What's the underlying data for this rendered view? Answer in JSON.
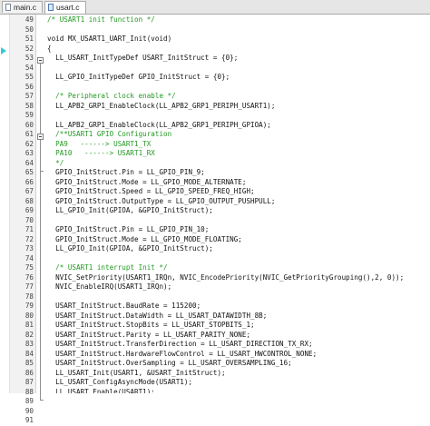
{
  "tabs": [
    {
      "label": "main.c",
      "active": false
    },
    {
      "label": "usart.c",
      "active": true
    }
  ],
  "colors": {
    "comment": "#229922",
    "code": "#111111",
    "current_line_marker": "#38c7d6"
  },
  "editor": {
    "lines": [
      {
        "num": "49",
        "text": "/* USART1 init function */",
        "type": "comment"
      },
      {
        "num": "50",
        "text": "",
        "type": "code"
      },
      {
        "num": "51",
        "text": "void MX_USART1_UART_Init(void)",
        "type": "code"
      },
      {
        "num": "52",
        "text": "{",
        "type": "code"
      },
      {
        "num": "53",
        "text": "  LL_USART_InitTypeDef USART_InitStruct = {0};",
        "type": "code"
      },
      {
        "num": "54",
        "text": "",
        "type": "code"
      },
      {
        "num": "55",
        "text": "  LL_GPIO_InitTypeDef GPIO_InitStruct = {0};",
        "type": "code"
      },
      {
        "num": "56",
        "text": "",
        "type": "code"
      },
      {
        "num": "57",
        "text": "  /* Peripheral clock enable */",
        "type": "comment"
      },
      {
        "num": "58",
        "text": "  LL_APB2_GRP1_EnableClock(LL_APB2_GRP1_PERIPH_USART1);",
        "type": "code"
      },
      {
        "num": "59",
        "text": "",
        "type": "code"
      },
      {
        "num": "60",
        "text": "  LL_APB2_GRP1_EnableClock(LL_APB2_GRP1_PERIPH_GPIOA);",
        "type": "code"
      },
      {
        "num": "61",
        "text": "  /**USART1 GPIO Configuration",
        "type": "comment"
      },
      {
        "num": "62",
        "text": "  PA9   ------> USART1_TX",
        "type": "comment"
      },
      {
        "num": "63",
        "text": "  PA10   ------> USART1_RX",
        "type": "comment"
      },
      {
        "num": "64",
        "text": "  */",
        "type": "comment"
      },
      {
        "num": "65",
        "text": "  GPIO_InitStruct.Pin = LL_GPIO_PIN_9;",
        "type": "code"
      },
      {
        "num": "66",
        "text": "  GPIO_InitStruct.Mode = LL_GPIO_MODE_ALTERNATE;",
        "type": "code"
      },
      {
        "num": "67",
        "text": "  GPIO_InitStruct.Speed = LL_GPIO_SPEED_FREQ_HIGH;",
        "type": "code"
      },
      {
        "num": "68",
        "text": "  GPIO_InitStruct.OutputType = LL_GPIO_OUTPUT_PUSHPULL;",
        "type": "code"
      },
      {
        "num": "69",
        "text": "  LL_GPIO_Init(GPIOA, &GPIO_InitStruct);",
        "type": "code"
      },
      {
        "num": "70",
        "text": "",
        "type": "code"
      },
      {
        "num": "71",
        "text": "  GPIO_InitStruct.Pin = LL_GPIO_PIN_10;",
        "type": "code"
      },
      {
        "num": "72",
        "text": "  GPIO_InitStruct.Mode = LL_GPIO_MODE_FLOATING;",
        "type": "code"
      },
      {
        "num": "73",
        "text": "  LL_GPIO_Init(GPIOA, &GPIO_InitStruct);",
        "type": "code"
      },
      {
        "num": "74",
        "text": "",
        "type": "code"
      },
      {
        "num": "75",
        "text": "  /* USART1 interrupt Init */",
        "type": "comment"
      },
      {
        "num": "76",
        "text": "  NVIC_SetPriority(USART1_IRQn, NVIC_EncodePriority(NVIC_GetPriorityGrouping(),2, 0));",
        "type": "code"
      },
      {
        "num": "77",
        "text": "  NVIC_EnableIRQ(USART1_IRQn);",
        "type": "code"
      },
      {
        "num": "78",
        "text": "",
        "type": "code"
      },
      {
        "num": "79",
        "text": "  USART_InitStruct.BaudRate = 115200;",
        "type": "code"
      },
      {
        "num": "80",
        "text": "  USART_InitStruct.DataWidth = LL_USART_DATAWIDTH_8B;",
        "type": "code"
      },
      {
        "num": "81",
        "text": "  USART_InitStruct.StopBits = LL_USART_STOPBITS_1;",
        "type": "code"
      },
      {
        "num": "82",
        "text": "  USART_InitStruct.Parity = LL_USART_PARITY_NONE;",
        "type": "code"
      },
      {
        "num": "83",
        "text": "  USART_InitStruct.TransferDirection = LL_USART_DIRECTION_TX_RX;",
        "type": "code"
      },
      {
        "num": "84",
        "text": "  USART_InitStruct.HardwareFlowControl = LL_USART_HWCONTROL_NONE;",
        "type": "code"
      },
      {
        "num": "85",
        "text": "  USART_InitStruct.OverSampling = LL_USART_OVERSAMPLING_16;",
        "type": "code"
      },
      {
        "num": "86",
        "text": "  LL_USART_Init(USART1, &USART_InitStruct);",
        "type": "code"
      },
      {
        "num": "87",
        "text": "  LL_USART_ConfigAsyncMode(USART1);",
        "type": "code"
      },
      {
        "num": "88",
        "text": "  LL_USART_Enable(USART1);",
        "type": "code"
      },
      {
        "num": "89",
        "text": "",
        "type": "code"
      },
      {
        "num": "90",
        "text": "}",
        "type": "code"
      },
      {
        "num": "91",
        "text": "",
        "type": "code"
      }
    ]
  }
}
